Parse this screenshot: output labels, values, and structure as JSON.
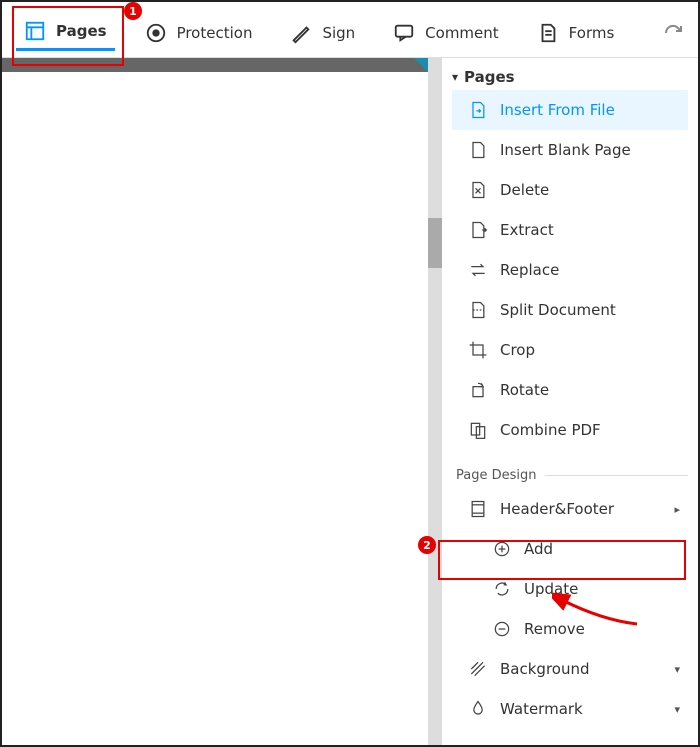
{
  "toolbar": {
    "pages": "Pages",
    "protection": "Protection",
    "sign": "Sign",
    "comment": "Comment",
    "forms": "Forms"
  },
  "panel": {
    "title": "Pages",
    "insert_from_file": "Insert From File",
    "insert_blank": "Insert Blank Page",
    "delete": "Delete",
    "extract": "Extract",
    "replace": "Replace",
    "split": "Split Document",
    "crop": "Crop",
    "rotate": "Rotate",
    "combine": "Combine PDF",
    "page_design": "Page Design",
    "header_footer": "Header&Footer",
    "add": "Add",
    "update": "Update",
    "remove": "Remove",
    "background": "Background",
    "watermark": "Watermark"
  }
}
